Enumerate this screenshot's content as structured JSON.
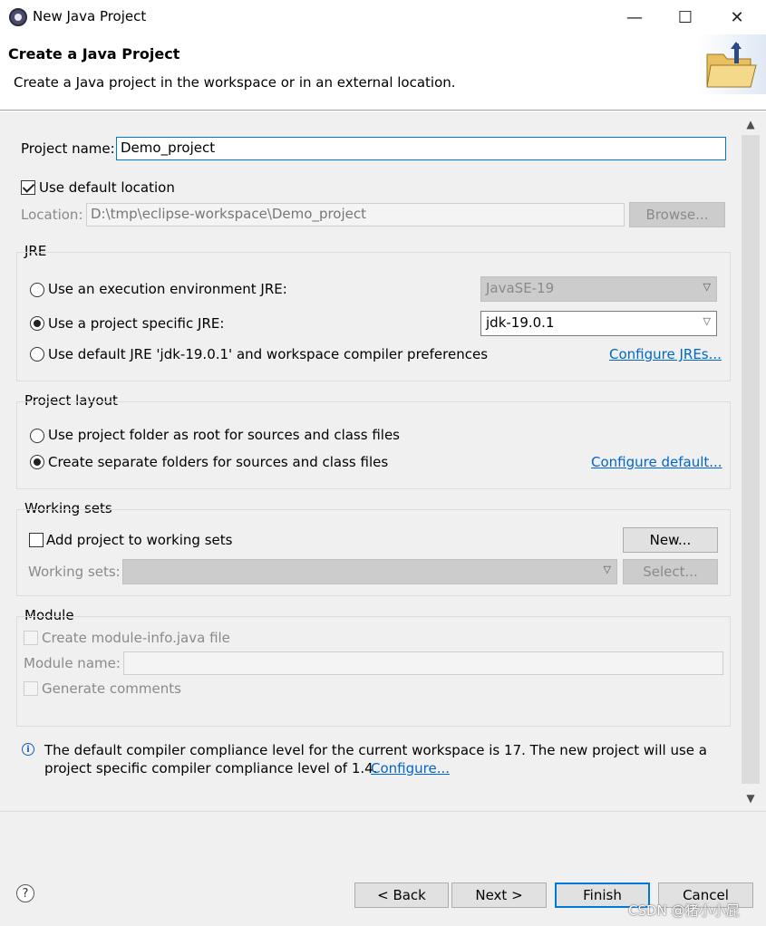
{
  "window": {
    "title": "New Java Project",
    "minimize_glyph": "—",
    "maximize_glyph": "☐",
    "close_glyph": "✕"
  },
  "header": {
    "title": "Create a Java Project",
    "description": "Create a Java project in the workspace or in an external location.",
    "banner_icon": "folder-icon"
  },
  "form": {
    "project_name_label": "Project name:",
    "project_name_value": "Demo_project",
    "use_default_location_label": "Use default location",
    "use_default_location_checked": true,
    "location_label": "Location:",
    "location_value": "D:\\tmp\\eclipse-workspace\\Demo_project",
    "browse_label": "Browse..."
  },
  "jre": {
    "group_label": "JRE",
    "option_exec_env": "Use an execution environment JRE:",
    "exec_env_value": "JavaSE-19",
    "option_specific": "Use a project specific JRE:",
    "specific_value": "jdk-19.0.1",
    "option_default": "Use default JRE 'jdk-19.0.1' and workspace compiler preferences",
    "configure_link": "Configure JREs...",
    "selected": "specific"
  },
  "layout": {
    "group_label": "Project layout",
    "option_root": "Use project folder as root for sources and class files",
    "option_separate": "Create separate folders for sources and class files",
    "configure_link": "Configure default...",
    "selected": "separate"
  },
  "working_sets": {
    "group_label": "Working sets",
    "add_label": "Add project to working sets",
    "new_button": "New...",
    "sets_label": "Working sets:",
    "select_button": "Select..."
  },
  "module": {
    "group_label": "Module",
    "create_label": "Create module-info.java file",
    "name_label": "Module name:",
    "comments_label": "Generate comments"
  },
  "info": {
    "line1": "The default compiler compliance level for the current workspace is 17. The new project will use a",
    "line2": "project specific compiler compliance level of 1.4.",
    "link": "Configure..."
  },
  "footer": {
    "help_glyph": "?",
    "back_label": "< Back",
    "next_label": "Next >",
    "finish_label": "Finish",
    "cancel_label": "Cancel"
  },
  "watermark": "CSDN @猪小小屁",
  "colors": {
    "link": "#0066cc",
    "focus_border": "#0078d7",
    "dialog_bg": "#f0f0f0"
  }
}
